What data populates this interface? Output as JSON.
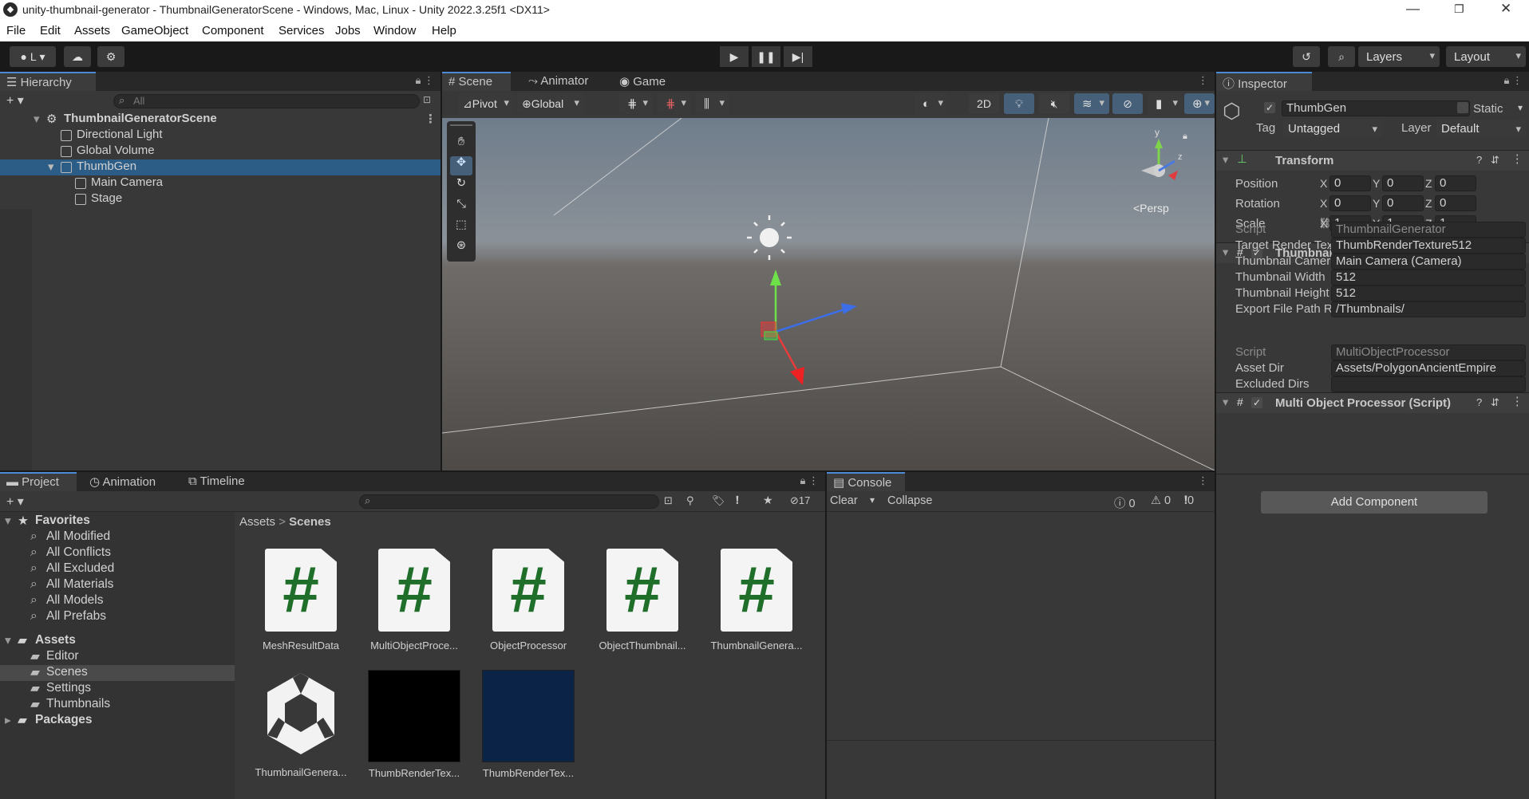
{
  "window": {
    "title": "unity-thumbnail-generator - ThumbnailGeneratorScene - Windows, Mac, Linux - Unity 2022.3.25f1 <DX11>"
  },
  "menu": [
    "File",
    "Edit",
    "Assets",
    "GameObject",
    "Component",
    "Services",
    "Jobs",
    "Window",
    "Help"
  ],
  "toolbar": {
    "account_label": "L",
    "layers_label": "Layers",
    "layout_label": "Layout"
  },
  "hierarchy": {
    "tab": "Hierarchy",
    "search_placeholder": "All",
    "items": [
      "ThumbnailGeneratorScene",
      "Directional Light",
      "Global Volume",
      "ThumbGen",
      "Main Camera",
      "Stage"
    ]
  },
  "sceneview": {
    "tabs": [
      "Scene",
      "Animator",
      "Game"
    ],
    "pivot": "Pivot",
    "global": "Global",
    "mode2d": "2D",
    "persp": "<Persp",
    "gizmo_y": "y",
    "gizmo_z": "z"
  },
  "inspector": {
    "tab": "Inspector",
    "object_name": "ThumbGen",
    "static_label": "Static",
    "tag_label": "Tag",
    "tag_value": "Untagged",
    "layer_label": "Layer",
    "layer_value": "Default",
    "transform": {
      "title": "Transform",
      "rows": [
        {
          "label": "Position",
          "x": "0",
          "y": "0",
          "z": "0"
        },
        {
          "label": "Rotation",
          "x": "0",
          "y": "0",
          "z": "0"
        },
        {
          "label": "Scale",
          "x": "1",
          "y": "1",
          "z": "1"
        }
      ],
      "axis_x": "X",
      "axis_y": "Y",
      "axis_z": "Z"
    },
    "thumbgen": {
      "title": "Thumbnail Generator (Script)",
      "rows": [
        {
          "label": "Script",
          "value": "ThumbnailGenerator"
        },
        {
          "label": "Target Render Textur",
          "value": "ThumbRenderTexture512"
        },
        {
          "label": "Thumbnail Camera",
          "value": "Main Camera (Camera)"
        },
        {
          "label": "Thumbnail Width",
          "value": "512"
        },
        {
          "label": "Thumbnail Height",
          "value": "512"
        },
        {
          "label": "Export File Path Root",
          "value": "/Thumbnails/"
        }
      ]
    },
    "multi": {
      "title": "Multi Object Processor (Script)",
      "rows": [
        {
          "label": "Script",
          "value": "MultiObjectProcessor"
        },
        {
          "label": "Asset Dir",
          "value": "Assets/PolygonAncientEmpire"
        },
        {
          "label": "Excluded Dirs",
          "value": ""
        }
      ]
    },
    "add_component": "Add Component"
  },
  "project": {
    "tabs": [
      "Project",
      "Animation",
      "Timeline"
    ],
    "hidden_count": "17",
    "favorites": {
      "label": "Favorites",
      "items": [
        "All Modified",
        "All Conflicts",
        "All Excluded",
        "All Materials",
        "All Models",
        "All Prefabs"
      ]
    },
    "assets": {
      "label": "Assets",
      "items": [
        "Editor",
        "Scenes",
        "Settings",
        "Thumbnails"
      ]
    },
    "packages": "Packages",
    "breadcrumb": [
      "Assets",
      "Scenes"
    ],
    "files": [
      "MeshResultData",
      "MultiObjectProce...",
      "ObjectProcessor",
      "ObjectThumbnail...",
      "ThumbnailGenera...",
      "ThumbnailGenera...",
      "ThumbRenderTex...",
      "ThumbRenderTex..."
    ]
  },
  "console": {
    "tab": "Console",
    "clear": "Clear",
    "collapse": "Collapse",
    "log_count": "0",
    "warn_count": "0",
    "error_count": "0"
  },
  "colors": {
    "accent": "#2c5d87",
    "selected_tab": "#4d8bd6",
    "script_green": "#1f6f2a",
    "render_tex_blue": "#0b2346"
  }
}
